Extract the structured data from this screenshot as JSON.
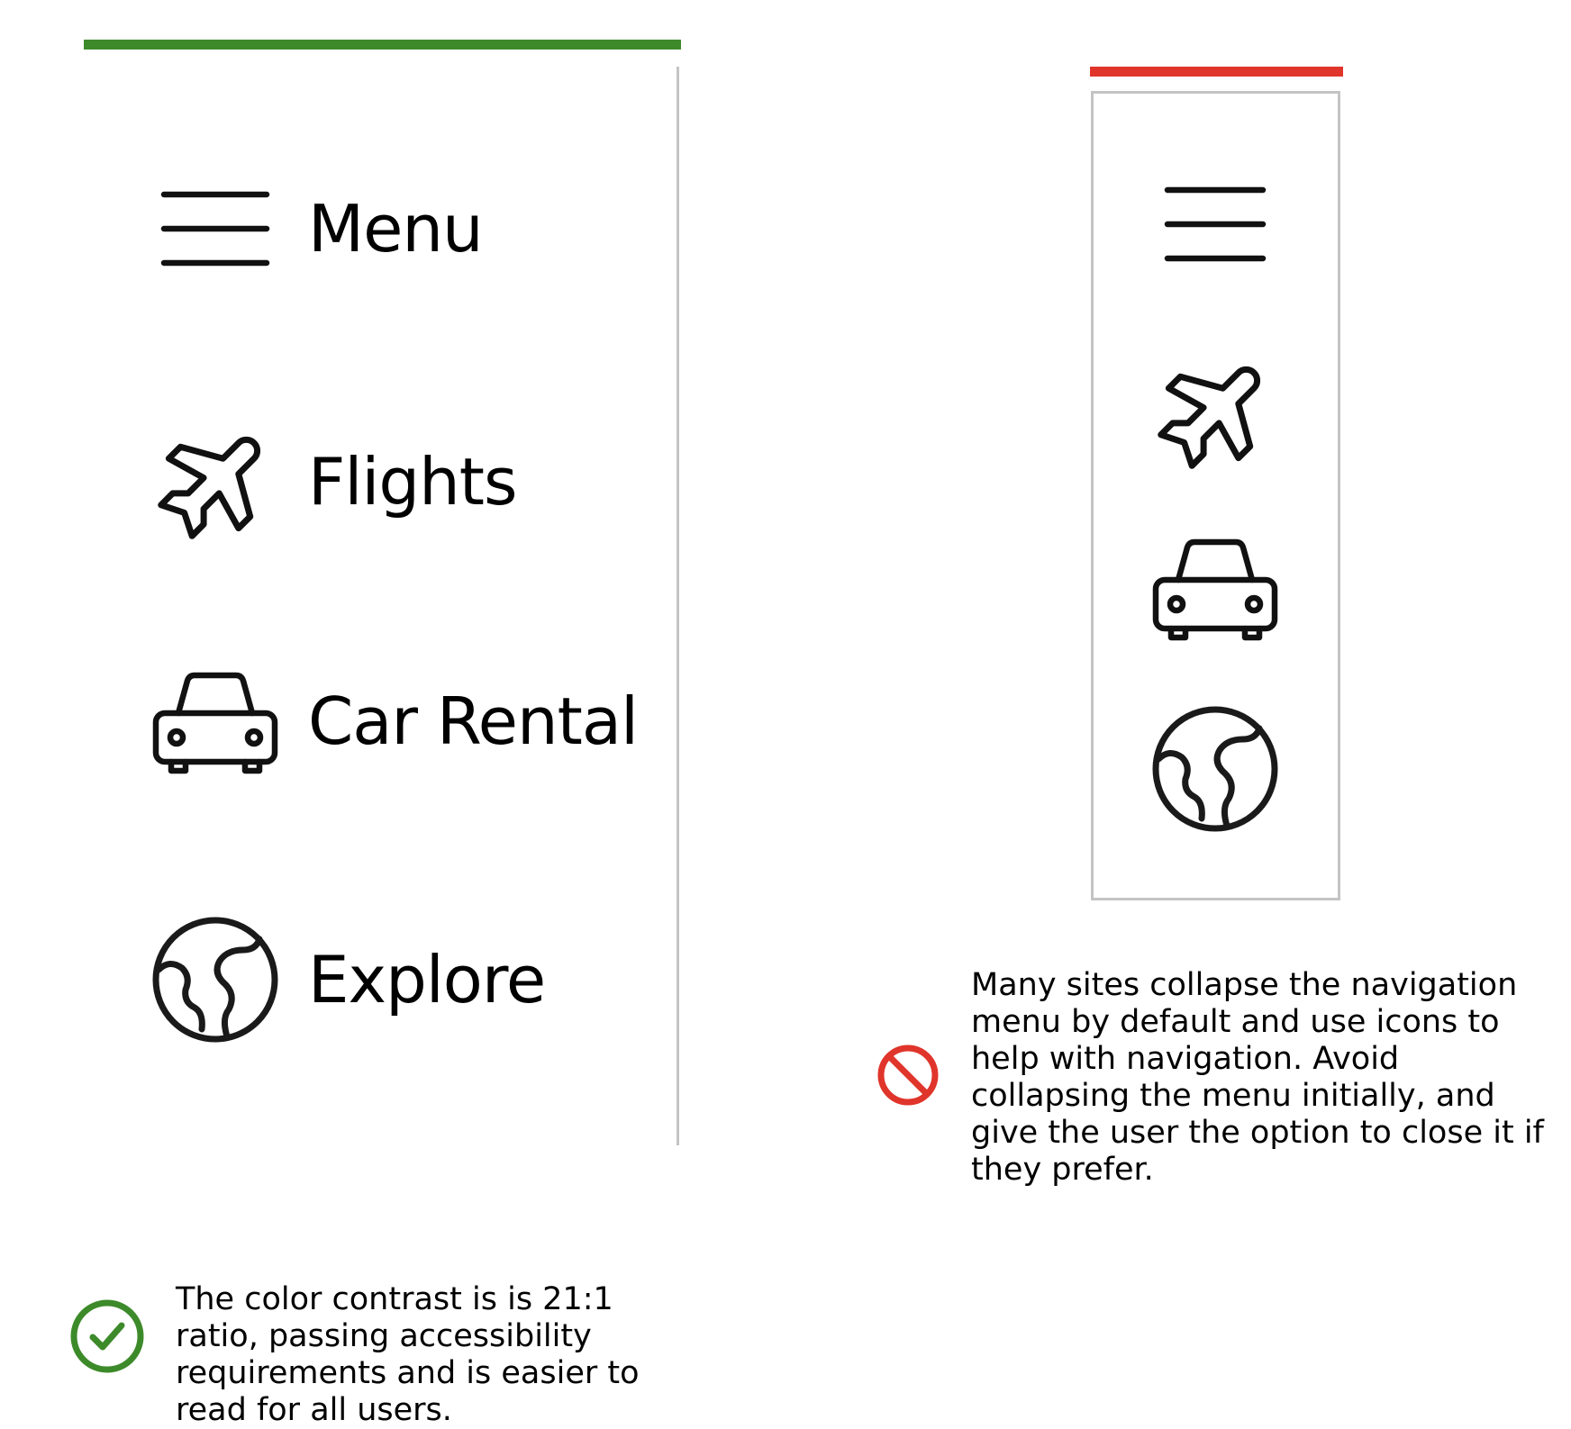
{
  "good_example": {
    "accent_color": "#3d8a2a",
    "nav_items": [
      {
        "label": "Menu",
        "icon": "hamburger-menu-icon"
      },
      {
        "label": "Flights",
        "icon": "airplane-icon"
      },
      {
        "label": "Car Rental",
        "icon": "car-icon"
      },
      {
        "label": "Explore",
        "icon": "globe-icon"
      }
    ],
    "note": {
      "icon": "checkmark-circle-icon",
      "text": "The color contrast is is 21:1 ratio, passing accessibility requirements and is easier to read for all users."
    }
  },
  "bad_example": {
    "accent_color": "#e0352b",
    "collapsed_icons": [
      "hamburger-menu-icon",
      "airplane-icon",
      "car-icon",
      "globe-icon"
    ],
    "note": {
      "icon": "prohibited-icon",
      "text": "Many sites collapse the navigation menu by default and use icons to help with navigation. Avoid collapsing the menu initially, and give the user the option to close it if they prefer."
    }
  }
}
